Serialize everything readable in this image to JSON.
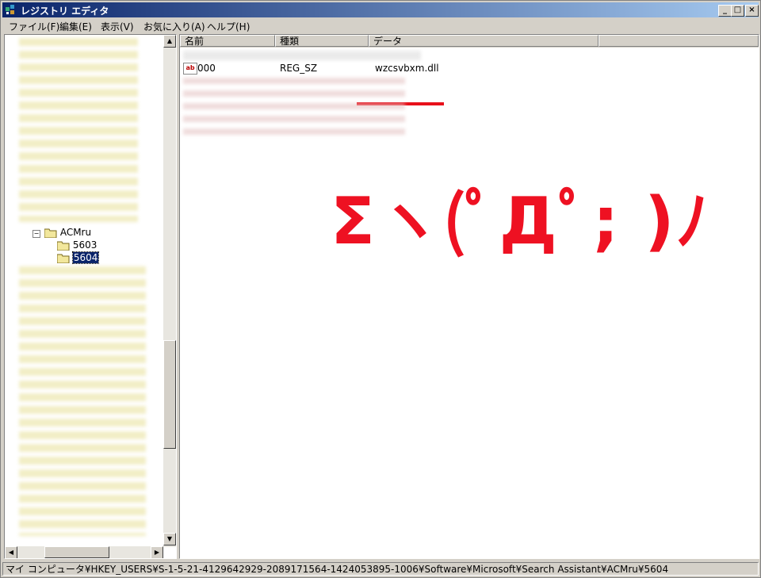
{
  "window": {
    "title": "レジストリ エディタ"
  },
  "menu": [
    {
      "label": "ファイル(F)"
    },
    {
      "label": "編集(E)"
    },
    {
      "label": "表示(V)"
    },
    {
      "label": "お気に入り(A)"
    },
    {
      "label": "ヘルプ(H)"
    }
  ],
  "tree": {
    "expanded_node": "ACMru",
    "children": [
      "5603",
      "5604"
    ],
    "selected": "5604"
  },
  "list": {
    "columns": [
      "名前",
      "種類",
      "データ"
    ],
    "rows": [
      {
        "name": "000",
        "type": "REG_SZ",
        "data": "wzcsvbxm.dll"
      }
    ]
  },
  "overlay": {
    "kaomoji": "Σヽ(ﾟДﾟ; )ﾉ",
    "color": "#e8101a"
  },
  "status": {
    "path": "マイ コンピュータ¥HKEY_USERS¥S-1-5-21-4129642929-2089171564-1424053895-1006¥Software¥Microsoft¥Search Assistant¥ACMru¥5604"
  }
}
